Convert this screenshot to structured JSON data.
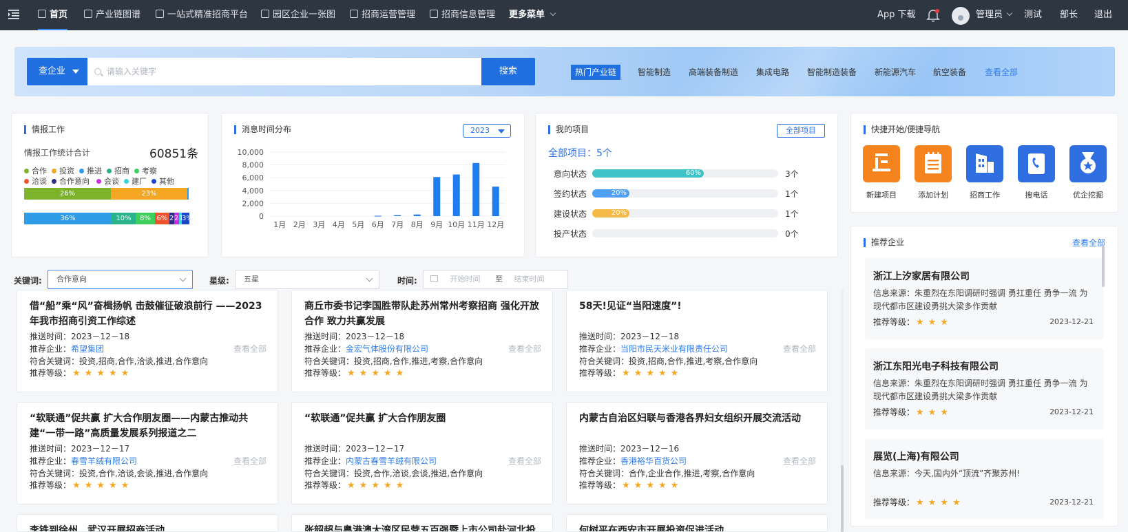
{
  "nav": {
    "items": [
      {
        "label": "首页",
        "icon": "home-icon"
      },
      {
        "label": "产业链图谱",
        "icon": "chain-icon"
      },
      {
        "label": "一站式精准招商平台",
        "icon": "platform-icon"
      },
      {
        "label": "园区企业一张图",
        "icon": "map-icon"
      },
      {
        "label": "招商运营管理",
        "icon": "ops-icon"
      },
      {
        "label": "招商信息管理",
        "icon": "info-icon"
      }
    ],
    "more": "更多菜单",
    "app_download": "App 下载",
    "user": "管理员",
    "links": [
      "测试",
      "部长",
      "退出"
    ]
  },
  "search": {
    "type": "查企业",
    "placeholder": "请输入关键字",
    "button": "搜索",
    "hot_tag": "热门产业链",
    "hot_links": [
      "智能制造",
      "高端装备制造",
      "集成电路",
      "智能制造装备",
      "新能源汽车",
      "航空装备"
    ],
    "view_all": "查看全部"
  },
  "intel": {
    "title": "情报工作",
    "total_label": "情报工作统计合计",
    "total_value": "60851条",
    "legend": [
      {
        "name": "合作",
        "color": "#7cb32a"
      },
      {
        "name": "投资",
        "color": "#f5a623"
      },
      {
        "name": "推进",
        "color": "#2e9ce6"
      },
      {
        "name": "招商",
        "color": "#29b38a"
      },
      {
        "name": "考察",
        "color": "#3ccf5c"
      },
      {
        "name": "洽谈",
        "color": "#f0522d"
      },
      {
        "name": "合作意向",
        "color": "#2b2f8a"
      },
      {
        "name": "会谈",
        "color": "#c72fe0"
      },
      {
        "name": "建厂",
        "color": "#39d3d9"
      },
      {
        "name": "其他",
        "color": "#1d47c9"
      }
    ],
    "bar1": [
      {
        "label": "26%",
        "value": 26,
        "color": "#7cb32a"
      },
      {
        "label": "23%",
        "value": 23,
        "color": "#f5a623"
      },
      {
        "label": "",
        "value": 0.5,
        "color": "#2e9ce6"
      }
    ],
    "bar2": [
      {
        "label": "36%",
        "value": 36,
        "color": "#2e9ce6"
      },
      {
        "label": "10%",
        "value": 10,
        "color": "#29b38a"
      },
      {
        "label": "8%",
        "value": 8,
        "color": "#3ccf5c"
      },
      {
        "label": "6%",
        "value": 6,
        "color": "#f0522d"
      },
      {
        "label": "2%",
        "value": 2,
        "color": "#2b2f8a"
      },
      {
        "label": "2%",
        "value": 2,
        "color": "#c72fe0"
      },
      {
        "label": "1%",
        "value": 1,
        "color": "#39d3d9"
      },
      {
        "label": "3%",
        "value": 3,
        "color": "#1d47c9"
      }
    ]
  },
  "msgchart": {
    "title": "消息时间分布",
    "year": "2023",
    "chart_data": {
      "type": "bar",
      "categories": [
        "1月",
        "2月",
        "3月",
        "4月",
        "5月",
        "6月",
        "7月",
        "8月",
        "9月",
        "10月",
        "11月",
        "12月"
      ],
      "values": [
        0,
        0,
        0,
        0,
        0,
        50,
        150,
        250,
        6100,
        6500,
        8300,
        4600
      ],
      "ylim": [
        0,
        10000
      ],
      "yticks": [
        "10,000",
        "8,000",
        "6,000",
        "4,000",
        "2,000",
        "0"
      ],
      "color": "#1e7ef0",
      "grid": true
    }
  },
  "projects": {
    "title": "我的项目",
    "all_button": "全部项目",
    "summary": "全部项目：5个",
    "rows": [
      {
        "label": "意向状态",
        "percent": 60,
        "pct_label": "60%",
        "count": "3个",
        "color": "#3fc3c7"
      },
      {
        "label": "签约状态",
        "percent": 20,
        "pct_label": "20%",
        "count": "1个",
        "color": "#4fa0f2"
      },
      {
        "label": "建设状态",
        "percent": 20,
        "pct_label": "20%",
        "count": "1个",
        "color": "#f5b945"
      },
      {
        "label": "投产状态",
        "percent": 0,
        "pct_label": "",
        "count": "0个",
        "color": "#4fa0f2"
      }
    ]
  },
  "quicknav": {
    "title": "快捷开始/便捷导航",
    "items": [
      {
        "label": "新建项目",
        "icon": "new-project-icon",
        "color": "#f5841f"
      },
      {
        "label": "添加计划",
        "icon": "add-plan-icon",
        "color": "#f5841f"
      },
      {
        "label": "招商工作",
        "icon": "building-icon",
        "color": "#2f6ee0"
      },
      {
        "label": "搜电话",
        "icon": "phone-search-icon",
        "color": "#2f6ee0"
      },
      {
        "label": "优企挖掘",
        "icon": "medal-icon",
        "color": "#2f6ee0"
      }
    ]
  },
  "filters": {
    "keyword_label": "关键词:",
    "keyword_value": "合作意向",
    "star_label": "星级:",
    "star_value": "五星",
    "time_label": "时间:",
    "time_start": "开始时间",
    "time_sep": "至",
    "time_end": "结束时间"
  },
  "news": {
    "time_label": "推送时间：",
    "company_label": "推荐企业：",
    "kw_label": "符合关键词：",
    "level_label": "推荐等级：",
    "more": "查看全部",
    "stars": "★★★★★",
    "items": [
      {
        "title": "借“船”乘“风”奋楫扬帆 击鼓催征破浪前行 ——2023年我市招商引资工作综述",
        "time": "2023－12－18",
        "company": "希望集团",
        "keywords": "投资,招商,合作,洽谈,推进,合作意向"
      },
      {
        "title": "商丘市委书记李国胜带队赴苏州常州考察招商 强化开放合作 致力共赢发展",
        "time": "2023－12－18",
        "company": "金宏气体股份有限公司",
        "keywords": "投资,招商,合作,推进,考察,合作意向"
      },
      {
        "title": "58天!见证“当阳速度”!",
        "time": "2023－12－18",
        "company": "当阳市民天米业有限责任公司",
        "keywords": "投资,招商,合作,推进,考察,合作意向"
      },
      {
        "title": "“软联通”促共赢 扩大合作朋友圈——内蒙古推动共建“一带一路”高质量发展系列报道之二",
        "time": "2023－12－17",
        "company": "春雪羊绒有限公司",
        "keywords": "投资,合作,洽谈,会谈,推进,合作意向"
      },
      {
        "title": "“软联通”促共赢 扩大合作朋友圈",
        "time": "2023－12－17",
        "company": "内蒙古春雪羊绒有限公司",
        "keywords": "投资,合作,洽谈,会谈,推进,合作意向"
      },
      {
        "title": "内蒙古自治区妇联与香港各界妇女组织开展交流活动",
        "time": "2023－12－16",
        "company": "香港裕华百货公司",
        "keywords": "合作,企业合作,推进,考察,合作意向"
      },
      {
        "title": "李铁到徐州、武汉开展招商活动",
        "time": "",
        "company": "",
        "keywords": ""
      },
      {
        "title": "张韶超与粤港澳大湾区民营五百强暨上市公司赴河北投",
        "time": "",
        "company": "",
        "keywords": ""
      },
      {
        "title": "何树平在西安市开展投资促进活动",
        "time": "",
        "company": "",
        "keywords": ""
      }
    ]
  },
  "recommend": {
    "title": "推荐企业",
    "view_all": "查看全部",
    "source_label": "信息来源：",
    "level_label": "推荐等级：",
    "items": [
      {
        "name": "浙江上汐家居有限公司",
        "source": "朱重烈在东阳调研时强调 勇扛重任 勇争一流 为现代都市区建设勇挑大梁多作贡献",
        "stars": "★★★",
        "date": "2023-12-21"
      },
      {
        "name": "浙江东阳光电子科技有限公司",
        "source": "朱重烈在东阳调研时强调 勇扛重任 勇争一流 为现代都市区建设勇挑大梁多作贡献",
        "stars": "★★★",
        "date": "2023-12-21"
      },
      {
        "name": "展览(上海)有限公司",
        "source": "今天,国内外“顶流”齐聚苏州!",
        "stars": "★★★★",
        "date": "2023-12-21"
      }
    ]
  }
}
